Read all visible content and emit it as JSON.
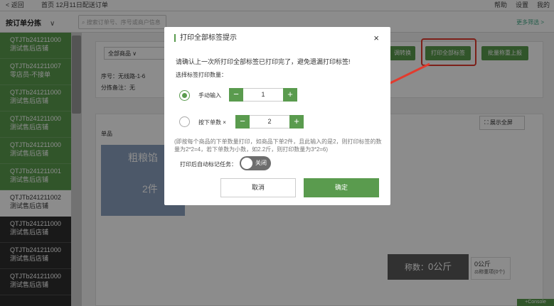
{
  "topbar": {
    "back": "< 返回",
    "title": "首页 12月11日配送订单",
    "help": "帮助",
    "settings": "设置",
    "profile": "我的"
  },
  "filterbar": {
    "sort_label": "按订单分拣",
    "search_placeholder": "搜索订单号、序号或商户信息",
    "more_filter": "更多筛选 >"
  },
  "sidebar": {
    "orders": [
      {
        "code": "QTJTb241211000",
        "shop": "测试售后店铺",
        "state": "green"
      },
      {
        "code": "QTJTb241211007",
        "shop": "零店员-不接单",
        "state": "green"
      },
      {
        "code": "QTJTb241211000",
        "shop": "测试售后店铺",
        "state": "green"
      },
      {
        "code": "QTJTb241211000",
        "shop": "测试售后店铺",
        "state": "green"
      },
      {
        "code": "QTJTb241211000",
        "shop": "测试售后店铺",
        "state": "green"
      },
      {
        "code": "QTJTb241211001",
        "shop": "测试售后店铺",
        "state": "green"
      },
      {
        "code": "QTJTb241211002",
        "shop": "测试售后店铺",
        "state": "selected"
      },
      {
        "code": "QTJTb241211000",
        "shop": "测试售后店铺",
        "state": "dark"
      },
      {
        "code": "QTJTb241211000",
        "shop": "测试售后店铺",
        "state": "dark"
      },
      {
        "code": "QTJTb241211000",
        "shop": "测试售后店铺",
        "state": "dark"
      }
    ]
  },
  "main": {
    "goods_select": "全部商品",
    "seq_text": "序号：无线路-1-6",
    "pick_note": "分拣备注：无",
    "btn_exchange": "调转换",
    "btn_print_all": "打印全部标签",
    "btn_batch": "批量称重上报",
    "fullscreen": "展示全屏",
    "label_single": "单品",
    "product_name": "粗粮馅",
    "product_qty": "2件",
    "weigh_label": "称数：",
    "weigh_value": "0公斤",
    "weight_side_value": "0公斤",
    "weight_side_note": "称重项(0个)",
    "corner_badge": "+Console"
  },
  "modal": {
    "title": "打印全部标签提示",
    "close": "×",
    "notice": "请确认上一次所打印全部标签已打印完了，避免遗漏打印标签!",
    "choose_label": "选择标签打印数量：",
    "option_manual": "手动输入",
    "option_manual_value": "1",
    "option_by_count": "按下单数 ×",
    "option_by_count_value": "2",
    "minus": "−",
    "plus": "+",
    "hint": "(即按每个商品的下单数量打印，如商品下单2件，且此输入的是2，则打印标签的数量为2*2=4，若下单数为小数，如2.2斤，则打印数量为3*2=6)",
    "autotag_label": "打印后自动标记任务：",
    "toggle_text": "关闭",
    "cancel": "取消",
    "confirm": "确定"
  },
  "colors": {
    "accent_green": "#5a9b4e",
    "highlight_red": "#e23b2e"
  }
}
